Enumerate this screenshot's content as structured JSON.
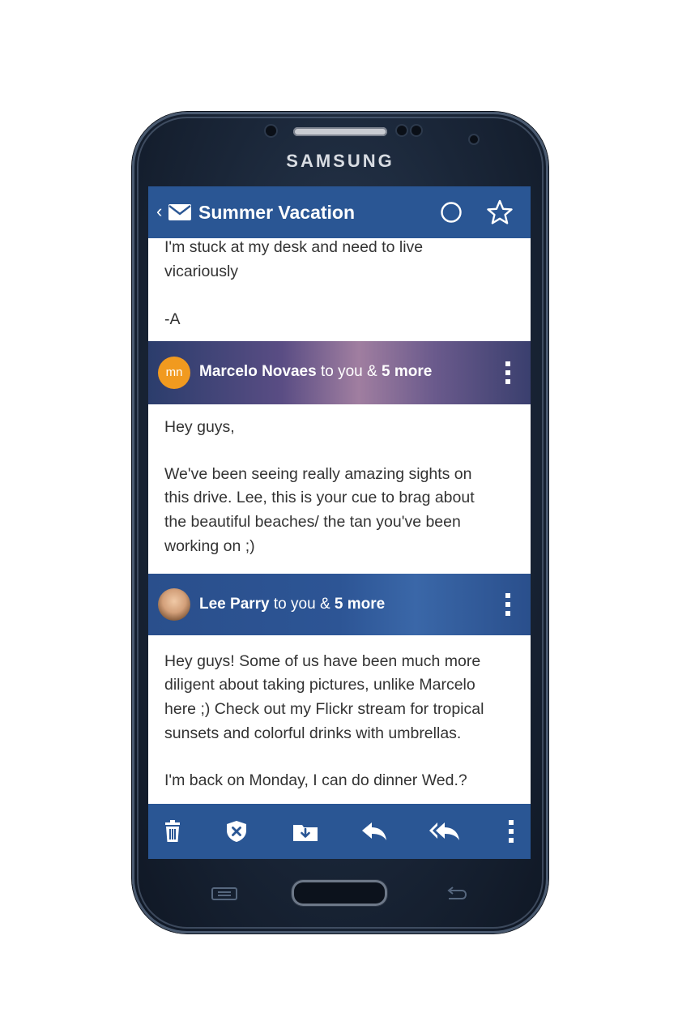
{
  "device": {
    "brand": "SAMSUNG"
  },
  "header": {
    "back_glyph": "‹",
    "title": "Summer Vacation",
    "icons": [
      "back-icon",
      "mail-icon",
      "circle-icon",
      "star-icon"
    ]
  },
  "thread": {
    "prev_message_lines": [
      "I'm stuck at my desk and need to live",
      "vicariously",
      "-A"
    ],
    "messages": [
      {
        "avatar_initials": "mn",
        "sender": "Marcelo Novaes",
        "recipients_prefix": " to you & ",
        "recipients_count": "5 more",
        "body_lines": [
          "Hey guys,",
          "We've been seeing really amazing sights on",
          "this drive. Lee, this is your cue to brag about",
          "the beautiful beaches/ the tan you've been",
          "working on ;)"
        ]
      },
      {
        "sender": "Lee Parry",
        "recipients_prefix": " to you & ",
        "recipients_count": "5 more",
        "body_lines": [
          "Hey guys! Some of us have been much more",
          "diligent about taking pictures, unlike Marcelo",
          "here ;) Check out my Flickr stream for tropical",
          "sunsets and colorful drinks with umbrellas.",
          "I'm back on Monday, I can do dinner Wed.?"
        ]
      }
    ]
  },
  "toolbar": {
    "icons": [
      "trash-icon",
      "spam-shield-icon",
      "move-folder-icon",
      "reply-icon",
      "reply-all-icon",
      "more-icon"
    ]
  },
  "colors": {
    "header_blue": "#2a5694",
    "avatar_orange": "#f19a1f",
    "phone_body": "#1a2638"
  }
}
